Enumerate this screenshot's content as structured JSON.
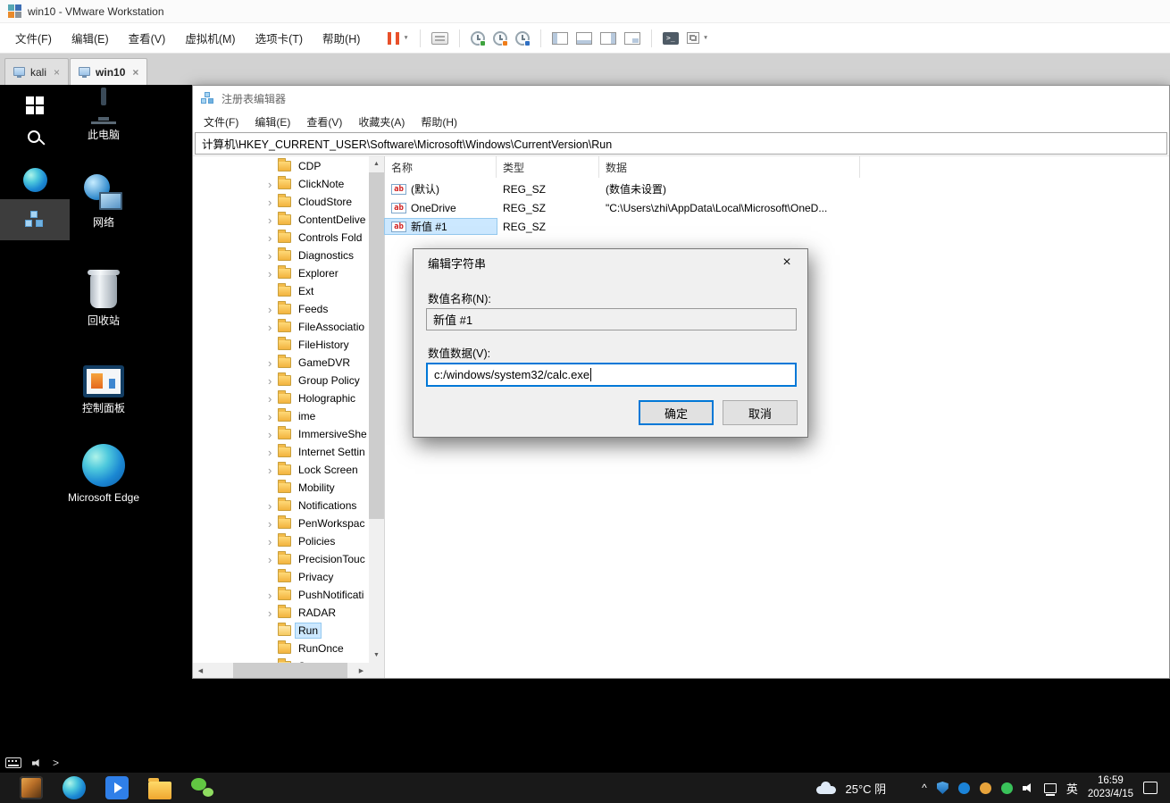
{
  "vmware": {
    "window_title": "win10 - VMware Workstation",
    "menu_items": [
      "文件(F)",
      "编辑(E)",
      "查看(V)",
      "虚拟机(M)",
      "选项卡(T)",
      "帮助(H)"
    ],
    "tabs": [
      {
        "label": "kali"
      },
      {
        "label": "win10"
      }
    ]
  },
  "icons": {
    "close_glyph": "×",
    "dropdown_caret": "▼",
    "tree_chevron": "›",
    "scroll_up": "▲",
    "scroll_down": "▼",
    "scroll_left": "◀",
    "scroll_right": "▶",
    "console_glyph": ">_",
    "reg_sz_glyph": "ab",
    "tray_chevron": "^",
    "pretaskbar_chevron": ">"
  },
  "desktop": {
    "icons": [
      {
        "label": "此电脑"
      },
      {
        "label": "网络"
      },
      {
        "label": "回收站"
      },
      {
        "label": "控制面板"
      },
      {
        "label": "Microsoft Edge"
      }
    ]
  },
  "regedit": {
    "title": "注册表编辑器",
    "menu_items": [
      "文件(F)",
      "编辑(E)",
      "查看(V)",
      "收藏夹(A)",
      "帮助(H)"
    ],
    "address": "计算机\\HKEY_CURRENT_USER\\Software\\Microsoft\\Windows\\CurrentVersion\\Run",
    "columns": [
      "名称",
      "类型",
      "数据"
    ],
    "tree": [
      {
        "label": "CDP",
        "expandable": false
      },
      {
        "label": "ClickNote",
        "expandable": true
      },
      {
        "label": "CloudStore",
        "expandable": true
      },
      {
        "label": "ContentDelive",
        "expandable": true
      },
      {
        "label": "Controls Fold",
        "expandable": true
      },
      {
        "label": "Diagnostics",
        "expandable": true
      },
      {
        "label": "Explorer",
        "expandable": true
      },
      {
        "label": "Ext",
        "expandable": false
      },
      {
        "label": "Feeds",
        "expandable": true
      },
      {
        "label": "FileAssociatio",
        "expandable": true
      },
      {
        "label": "FileHistory",
        "expandable": false
      },
      {
        "label": "GameDVR",
        "expandable": true
      },
      {
        "label": "Group Policy",
        "expandable": true
      },
      {
        "label": "Holographic",
        "expandable": true
      },
      {
        "label": "ime",
        "expandable": true
      },
      {
        "label": "ImmersiveShe",
        "expandable": true
      },
      {
        "label": "Internet Settin",
        "expandable": true
      },
      {
        "label": "Lock Screen",
        "expandable": true
      },
      {
        "label": "Mobility",
        "expandable": false
      },
      {
        "label": "Notifications",
        "expandable": true
      },
      {
        "label": "PenWorkspac",
        "expandable": true
      },
      {
        "label": "Policies",
        "expandable": true
      },
      {
        "label": "PrecisionTouc",
        "expandable": true
      },
      {
        "label": "Privacy",
        "expandable": false
      },
      {
        "label": "PushNotificati",
        "expandable": true
      },
      {
        "label": "RADAR",
        "expandable": true
      },
      {
        "label": "Run",
        "expandable": false,
        "selected": true
      },
      {
        "label": "RunOnce",
        "expandable": false
      },
      {
        "label": "Screensavers",
        "expandable": false
      }
    ],
    "rows": [
      {
        "name": "(默认)",
        "type": "REG_SZ",
        "data": "(数值未设置)"
      },
      {
        "name": "OneDrive",
        "type": "REG_SZ",
        "data": "\"C:\\Users\\zhi\\AppData\\Local\\Microsoft\\OneD..."
      },
      {
        "name": "新值 #1",
        "type": "REG_SZ",
        "data": "",
        "selected": true
      }
    ]
  },
  "dialog": {
    "title": "编辑字符串",
    "name_label": "数值名称(N):",
    "name_value": "新值 #1",
    "data_label": "数值数据(V):",
    "data_value": "c:/windows/system32/calc.exe",
    "ok_label": "确定",
    "cancel_label": "取消"
  },
  "taskbar": {
    "weather": "25°C 阴",
    "ime_indicator": "英",
    "time": "16:59",
    "date": "2023/4/15"
  }
}
